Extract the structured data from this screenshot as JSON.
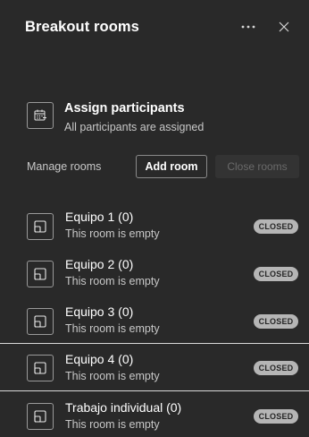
{
  "header": {
    "title": "Breakout rooms",
    "more_icon": "more-horizontal-icon",
    "close_icon": "close-icon"
  },
  "assign": {
    "icon": "calendar-assign-icon",
    "title": "Assign participants",
    "subtitle": "All participants are assigned"
  },
  "manage": {
    "label": "Manage rooms",
    "add_room": "Add room",
    "close_rooms": "Close rooms"
  },
  "rooms": [
    {
      "name": "Equipo 1 (0)",
      "status": "This room is empty",
      "badge": "CLOSED"
    },
    {
      "name": "Equipo 2 (0)",
      "status": "This room is empty",
      "badge": "CLOSED"
    },
    {
      "name": "Equipo 3 (0)",
      "status": "This room is empty",
      "badge": "CLOSED"
    },
    {
      "name": "Equipo 4 (0)",
      "status": "This room is empty",
      "badge": "CLOSED"
    },
    {
      "name": "Trabajo individual (0)",
      "status": "This room is empty",
      "badge": "CLOSED"
    }
  ],
  "colors": {
    "panel_bg": "#292929",
    "badge_bg": "#b5b5b5",
    "text_primary": "#ffffff",
    "text_secondary": "#c8c8c8"
  }
}
